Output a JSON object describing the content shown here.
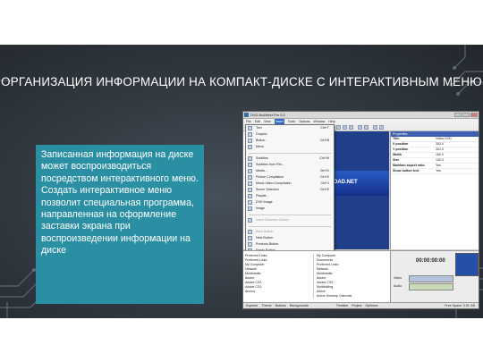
{
  "slide_title": "ОРГАНИЗАЦИЯ ИНФОРМАЦИИ НА КОМПАКТ-ДИСКЕ С ИНТЕРАКТИВНЫМ МЕНЮ",
  "description": "Записанная информация на диске может воспроизводиться посредством интерактивного меню. Создать интерактивное меню позволит специальная программа, направленная на оформление заставки экрана при воспроизведении информации на диске",
  "colors": {
    "textbox_bg": "#2b8fa3",
    "slide_bg": "#343b43",
    "menu_highlight": "#3169c6"
  },
  "app": {
    "window_title": "DVD Architect Pro 5.2",
    "menubar": [
      "File",
      "Edit",
      "View",
      "Insert",
      "Tools",
      "Options",
      "Window",
      "Help"
    ],
    "active_menu": "Insert",
    "dropdown": [
      {
        "label": "Text",
        "shortcut": "Ctrl+T",
        "icon": "text-icon"
      },
      {
        "label": "Graphic",
        "shortcut": "",
        "icon": "graphic-icon"
      },
      {
        "label": "Button",
        "shortcut": "Ctrl+B",
        "icon": "button-icon"
      },
      {
        "label": "Menu",
        "shortcut": "",
        "icon": "menu-icon"
      },
      {
        "label": "Subtitles",
        "shortcut": "Ctrl+M",
        "icon": "subtitles-icon"
      },
      {
        "label": "Subtitles from File...",
        "shortcut": "",
        "icon": "file-icon"
      },
      {
        "label": "Media...",
        "shortcut": "Ctrl+D",
        "icon": "media-icon"
      },
      {
        "label": "Picture Compilation",
        "shortcut": "Ctrl+K",
        "icon": "picture-icon"
      },
      {
        "label": "Music Video Compilation",
        "shortcut": "Ctrl+J",
        "icon": "music-icon"
      },
      {
        "label": "Scene Selection",
        "shortcut": "Ctrl+E",
        "icon": "scene-icon"
      },
      {
        "label": "Playlist...",
        "shortcut": "",
        "icon": "playlist-icon"
      },
      {
        "label": "DVD Image",
        "shortcut": "",
        "icon": "dvd-icon"
      },
      {
        "label": "Image",
        "shortcut": "",
        "icon": "image-icon"
      },
      {
        "label": "Insert Submenu Button",
        "shortcut": "",
        "icon": "submenu-icon",
        "disabled": true
      },
      {
        "label": "Back Button",
        "shortcut": "",
        "icon": "back-icon",
        "disabled": true
      },
      {
        "label": "Next Button",
        "shortcut": "",
        "icon": "next-icon"
      },
      {
        "label": "Previous Button",
        "shortcut": "",
        "icon": "prev-icon"
      },
      {
        "label": "Empty Button",
        "shortcut": "",
        "icon": "empty-icon"
      }
    ],
    "preview_label": "LOAD.NET",
    "properties": {
      "header": "Properties",
      "rows": [
        {
          "name": "Title",
          "value": "Video DVD"
        },
        {
          "name": "X position",
          "value": "353.0"
        },
        {
          "name": "Y position",
          "value": "302.0"
        },
        {
          "name": "Width",
          "value": "160.0"
        },
        {
          "name": "Size",
          "value": "130.0"
        },
        {
          "name": "Maintain aspect ratio",
          "value": "Yes"
        },
        {
          "name": "Show button text",
          "value": "Yes"
        }
      ]
    },
    "explorer_tree": [
      "Preferred Links",
      "Preferred Links",
      "My Computer",
      "Network",
      "Multimedia",
      "Adobe",
      "Adobe CS3",
      "Adobe CS3",
      "Anchor"
    ],
    "explorer_files": [
      "My Computer",
      "Documents",
      "Preferred Links",
      "Network",
      "Multimedia",
      "Adobe",
      "Adobe CS3",
      "Multifolding",
      "Active",
      "Active Desktop Calendar"
    ],
    "timecode": "00:00:00:00",
    "tracks": [
      "Video",
      "Audio"
    ],
    "tabs": [
      "Explorer",
      "Theme",
      "Buttons",
      "Backgrounds"
    ],
    "right_tabs": [
      "Timeline",
      "Project",
      "Optimize"
    ],
    "status": "Free Space: 3.91 GB"
  }
}
